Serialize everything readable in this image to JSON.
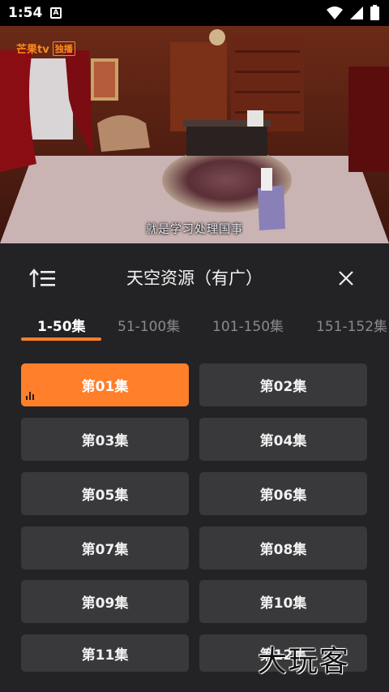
{
  "status_bar": {
    "time": "1:54",
    "notification_icon": "A"
  },
  "video": {
    "channel_logo": "芒果tv",
    "channel_badge": "独播",
    "subtitle": "就是学习处理国事"
  },
  "panel": {
    "title": "天空资源（有广）",
    "tabs": [
      {
        "label": "1-50集",
        "active": true
      },
      {
        "label": "51-100集",
        "active": false
      },
      {
        "label": "101-150集",
        "active": false
      },
      {
        "label": "151-152集",
        "active": false
      }
    ],
    "episodes": [
      {
        "label": "第01集",
        "active": true
      },
      {
        "label": "第02集",
        "active": false
      },
      {
        "label": "第03集",
        "active": false
      },
      {
        "label": "第04集",
        "active": false
      },
      {
        "label": "第05集",
        "active": false
      },
      {
        "label": "第06集",
        "active": false
      },
      {
        "label": "第07集",
        "active": false
      },
      {
        "label": "第08集",
        "active": false
      },
      {
        "label": "第09集",
        "active": false
      },
      {
        "label": "第10集",
        "active": false
      },
      {
        "label": "第11集",
        "active": false
      },
      {
        "label": "第12集",
        "active": false
      }
    ]
  },
  "watermark": "大玩客",
  "colors": {
    "accent": "#ff7f2a",
    "panel_bg": "#232325",
    "button_bg": "#39393c"
  }
}
